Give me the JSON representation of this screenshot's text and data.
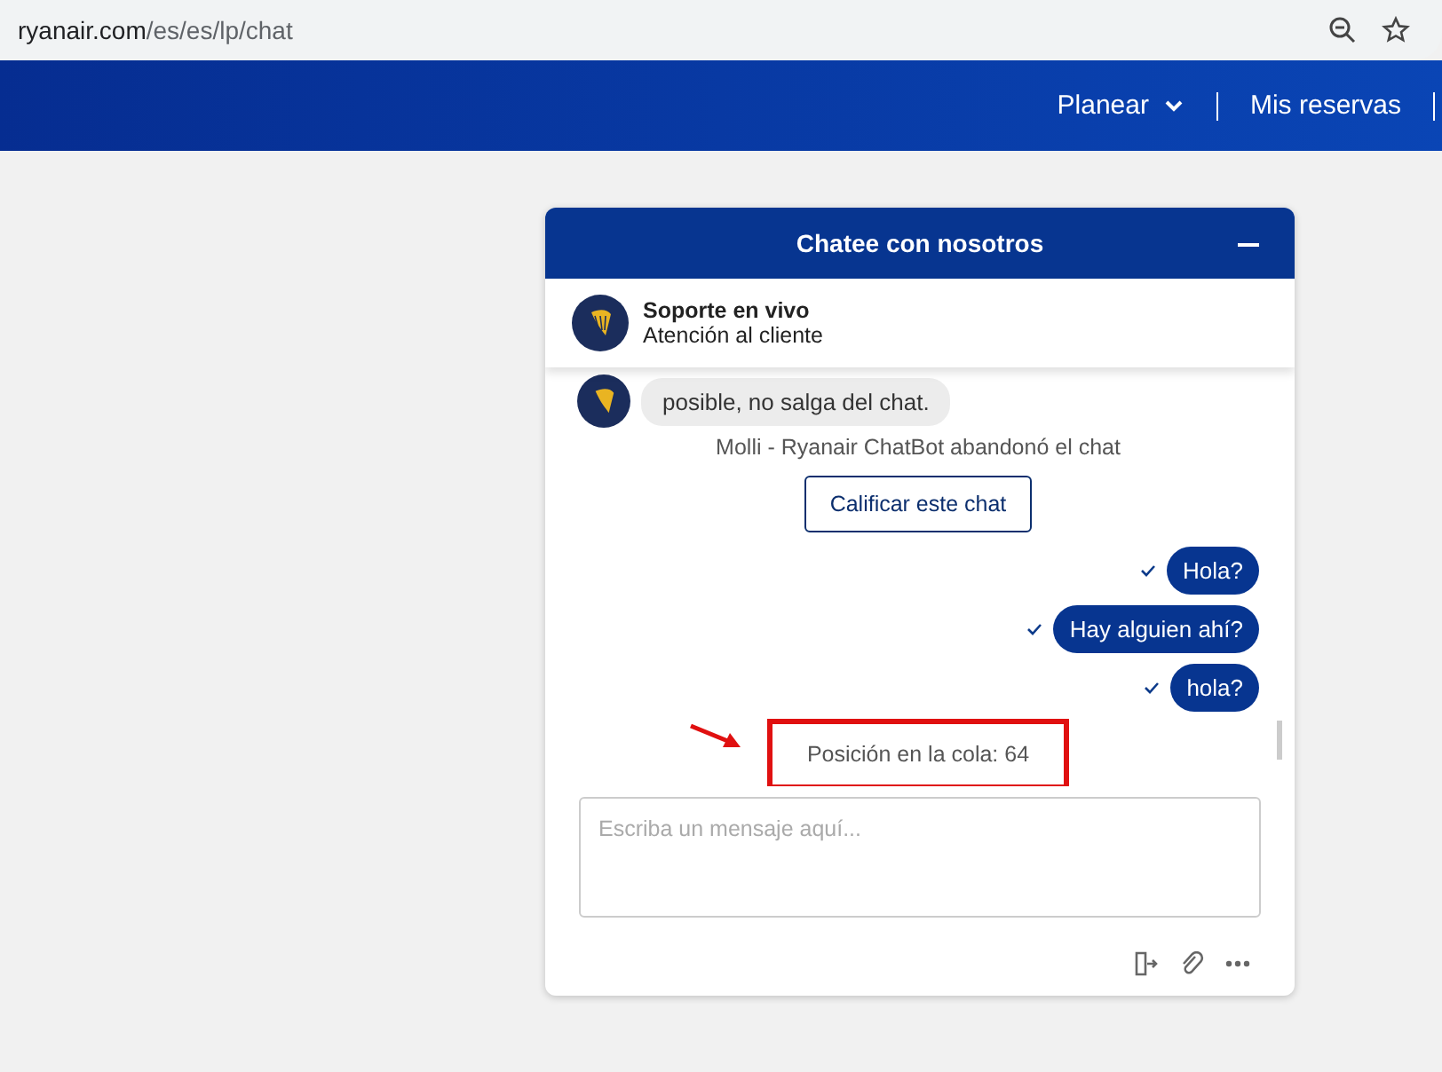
{
  "browser": {
    "url_host": "ryanair.com",
    "url_path": "/es/es/lp/chat"
  },
  "nav": {
    "items": [
      {
        "label": "Planear",
        "dropdown": true
      },
      {
        "label": "Mis reservas",
        "dropdown": false
      }
    ]
  },
  "chat": {
    "title": "Chatee con nosotros",
    "agent": {
      "name": "Soporte en vivo",
      "role": "Atención al cliente"
    },
    "messages": [
      {
        "kind": "bot",
        "text": "posible, no salga del chat."
      },
      {
        "kind": "system",
        "text": "Molli - Ryanair ChatBot abandonó el chat"
      },
      {
        "kind": "action",
        "text": "Calificar este chat"
      },
      {
        "kind": "user",
        "text": "Hola?",
        "delivered": true
      },
      {
        "kind": "user",
        "text": "Hay alguien ahí?",
        "delivered": true
      },
      {
        "kind": "user",
        "text": "hola?",
        "delivered": true
      },
      {
        "kind": "queue",
        "text": "Posición en la cola: 64",
        "highlighted": true
      }
    ],
    "input": {
      "placeholder": "Escriba un mensaje aquí..."
    }
  }
}
